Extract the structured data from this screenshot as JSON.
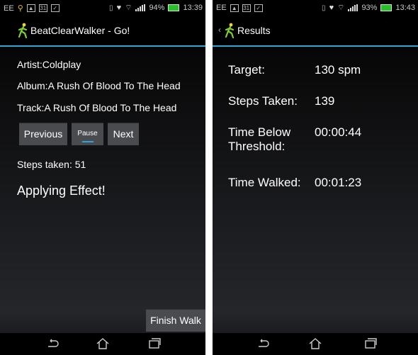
{
  "screen1": {
    "status": {
      "carrier": "EE",
      "battery": "94%",
      "time": "13:39"
    },
    "app_title": "BeatClearWalker - Go!",
    "artist": "Artist:Coldplay",
    "album": "Album:A Rush Of Blood To The Head",
    "track": "Track:A Rush Of Blood To The Head",
    "buttons": {
      "previous": "Previous",
      "pause": "Pause",
      "next": "Next"
    },
    "steps": "Steps taken: 51",
    "effect": "Applying Effect!",
    "finish": "Finish Walk"
  },
  "screen2": {
    "status": {
      "carrier": "EE",
      "battery": "93%",
      "time": "13:43"
    },
    "app_title": "Results",
    "rows": [
      {
        "label": "Target:",
        "value": "130 spm"
      },
      {
        "label": "Steps Taken:",
        "value": "139"
      },
      {
        "label": "Time Below Threshold:",
        "value": "00:00:44"
      },
      {
        "label": "Time Walked:",
        "value": "00:01:23"
      }
    ]
  },
  "icons": [
    "walker-logo-icon",
    "back-icon",
    "home-icon",
    "recent-apps-icon",
    "wifi-icon",
    "signal-icon",
    "battery-icon",
    "bluetooth-icon",
    "heart-icon"
  ]
}
